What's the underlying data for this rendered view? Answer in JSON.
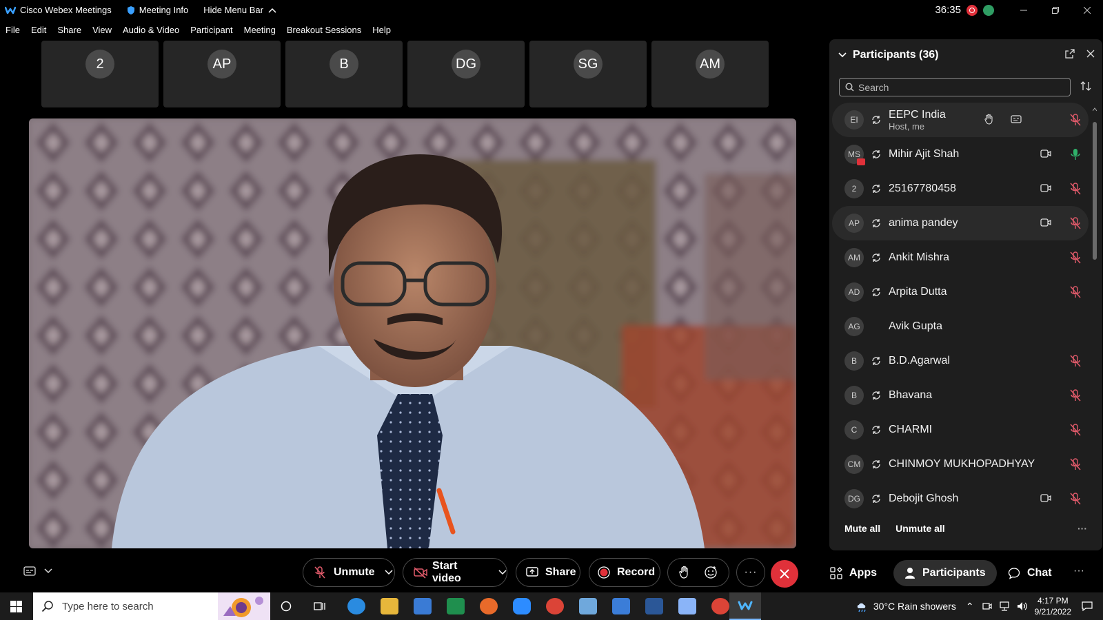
{
  "titlebar": {
    "app_name": "Cisco Webex Meetings",
    "meeting_info": "Meeting Info",
    "hide_menu": "Hide Menu Bar",
    "timer": "36:35"
  },
  "menu": [
    "File",
    "Edit",
    "Share",
    "View",
    "Audio & Video",
    "Participant",
    "Meeting",
    "Breakout Sessions",
    "Help"
  ],
  "thumbnails": [
    "2",
    "AP",
    "B",
    "DG",
    "SG",
    "AM"
  ],
  "panel": {
    "title": "Participants (36)",
    "search_placeholder": "Search",
    "mute_all": "Mute all",
    "unmute_all": "Unmute all"
  },
  "participants": [
    {
      "initials": "EI",
      "name": "EEPC India",
      "sub": "Host, me",
      "sync": true,
      "video": false,
      "mic": "muted",
      "hand": true,
      "cc": true,
      "highlight": true
    },
    {
      "initials": "MS",
      "name": "Mihir Ajit Shah",
      "sub": "",
      "sync": true,
      "video": true,
      "mic": "active",
      "badge": true
    },
    {
      "initials": "2",
      "name": "25167780458",
      "sub": "",
      "sync": true,
      "video": true,
      "mic": "muted"
    },
    {
      "initials": "AP",
      "name": "anima pandey",
      "sub": "",
      "sync": true,
      "video": true,
      "mic": "muted",
      "highlight": true
    },
    {
      "initials": "AM",
      "name": "Ankit Mishra",
      "sub": "",
      "sync": true,
      "video": false,
      "mic": "muted"
    },
    {
      "initials": "AD",
      "name": "Arpita Dutta",
      "sub": "",
      "sync": true,
      "video": false,
      "mic": "muted"
    },
    {
      "initials": "AG",
      "name": "Avik Gupta",
      "sub": "",
      "sync": false,
      "video": false,
      "mic": "none"
    },
    {
      "initials": "B",
      "name": "B.D.Agarwal",
      "sub": "",
      "sync": true,
      "video": false,
      "mic": "muted"
    },
    {
      "initials": "B",
      "name": "Bhavana",
      "sub": "",
      "sync": true,
      "video": false,
      "mic": "muted"
    },
    {
      "initials": "C",
      "name": "CHARMI",
      "sub": "",
      "sync": true,
      "video": false,
      "mic": "muted"
    },
    {
      "initials": "CM",
      "name": "CHINMOY MUKHOPADHYAY",
      "sub": "",
      "sync": true,
      "video": false,
      "mic": "muted"
    },
    {
      "initials": "DG",
      "name": "Debojit Ghosh",
      "sub": "",
      "sync": true,
      "video": true,
      "mic": "muted"
    }
  ],
  "controls": {
    "unmute": "Unmute",
    "start_video": "Start video",
    "share": "Share",
    "record": "Record",
    "apps": "Apps",
    "participants": "Participants",
    "chat": "Chat"
  },
  "taskbar": {
    "search_placeholder": "Type here to search",
    "weather": "30°C  Rain showers",
    "time": "4:17 PM",
    "date": "9/21/2022"
  },
  "colors": {
    "end_call": "#e0313a",
    "panel_bg": "#1e1e1e",
    "muted_mic": "#e05a6a",
    "active_mic": "#2fb36a"
  }
}
